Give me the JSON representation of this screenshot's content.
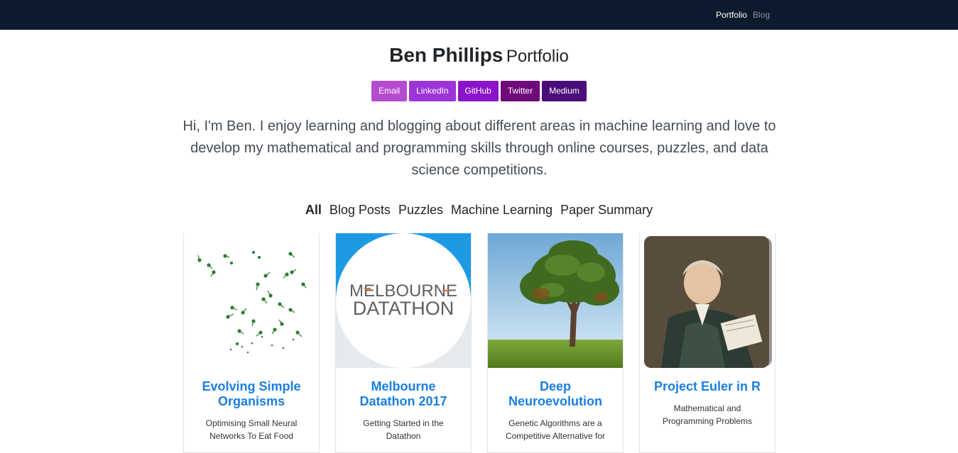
{
  "nav": {
    "items": [
      {
        "label": "Portfolio"
      },
      {
        "label": "Blog"
      }
    ]
  },
  "header": {
    "name": "Ben Phillips",
    "subtitle": "Portfolio"
  },
  "social": [
    {
      "label": "Email",
      "color": "#b54bd1"
    },
    {
      "label": "LinkedIn",
      "color": "#9c34d8"
    },
    {
      "label": "GitHub",
      "color": "#8a14c9"
    },
    {
      "label": "Twitter",
      "color": "#6f0a7a"
    },
    {
      "label": "Medium",
      "color": "#4b0d7a"
    }
  ],
  "intro": "Hi, I'm Ben. I enjoy learning and blogging about different areas in machine learning and love to develop my mathematical and programming skills through online courses, puzzles, and data science competitions.",
  "filters": [
    {
      "label": "All"
    },
    {
      "label": "Blog Posts"
    },
    {
      "label": "Puzzles"
    },
    {
      "label": "Machine Learning"
    },
    {
      "label": "Paper Summary"
    }
  ],
  "cards": [
    {
      "title": "Evolving Simple Organisms",
      "desc": "Optimising Small Neural Networks To Eat Food",
      "image": "organism-scatter-image"
    },
    {
      "title": "Melbourne Datathon 2017",
      "desc": "Getting Started in the Datathon",
      "image": "melbourne-datathon-logo",
      "logo_line1": "MELBOURNE",
      "logo_line2": "DATATHON"
    },
    {
      "title": "Deep Neuroevolution",
      "desc": "Genetic Algorithms are a Competitive Alternative for",
      "image": "tree-photo"
    },
    {
      "title": "Project Euler in R",
      "desc": "Mathematical and Programming Problems",
      "image": "euler-portrait"
    }
  ],
  "colors": {
    "navbar": "#0b1b2d",
    "link_blue": "#1a7fe0"
  }
}
